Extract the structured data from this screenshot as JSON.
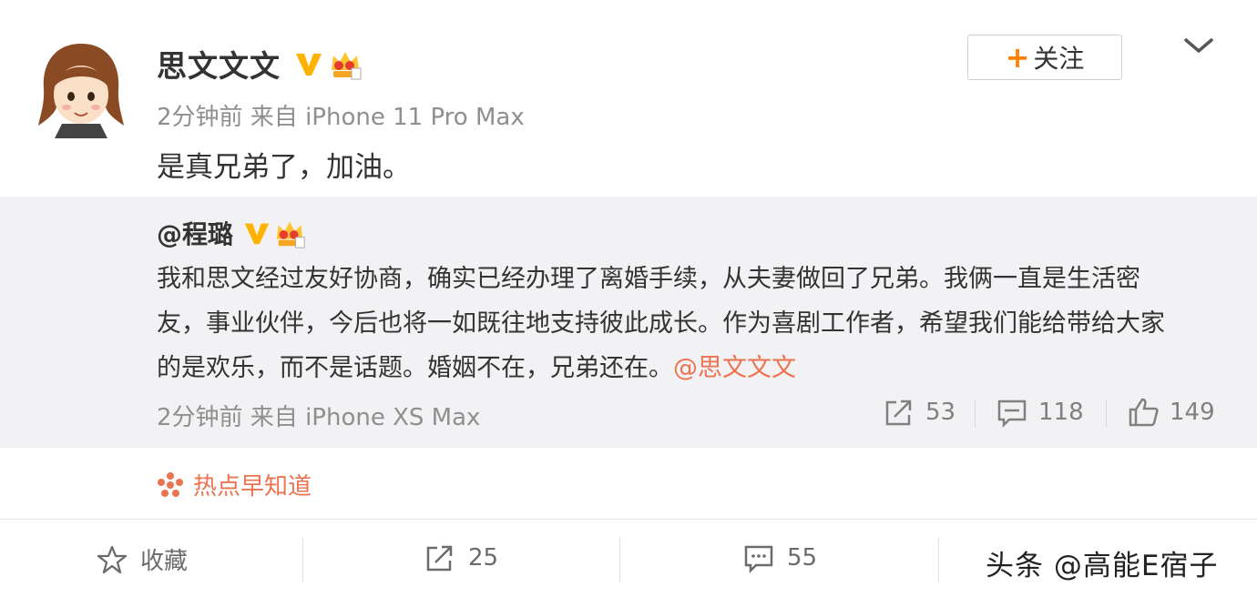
{
  "post": {
    "author": "思文文文",
    "meta": "2分钟前 来自 iPhone 11 Pro Max",
    "text": "是真兄弟了，加油。",
    "follow_label": "关注"
  },
  "repost": {
    "author": "@程璐",
    "lines": [
      "我和思文经过友好协商，确实已经办理了离婚手续，从夫妻做回了兄弟。我俩一直是生活密",
      "友，事业伙伴，今后也将一如既往地支持彼此成长。作为喜剧工作者，希望我们能给带给大家",
      "的是欢乐，而不是话题。婚姻不在，兄弟还在。"
    ],
    "mention": "@思文文文",
    "meta": "2分钟前 来自 iPhone XS Max",
    "reposts": "53",
    "comments": "118",
    "likes": "149"
  },
  "hot_topic": "热点早知道",
  "actions": {
    "favorite": "收藏",
    "reposts": "25",
    "comments": "55"
  },
  "watermark": "头条 @高能E宿子",
  "icons": [
    "vip-v-icon",
    "crown-badge-icon",
    "chevron-down-icon",
    "repost-icon",
    "comment-icon",
    "like-icon",
    "hot-icon",
    "star-icon"
  ],
  "colors": {
    "accent": "#ff8200",
    "mention": "#eb7350",
    "repost_bg": "#f2f2f5",
    "meta": "#8f8f8f"
  }
}
